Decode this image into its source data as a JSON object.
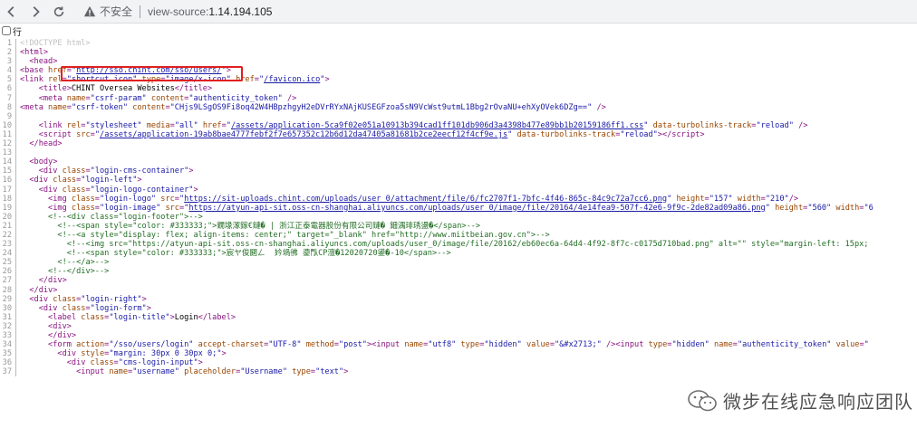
{
  "browser": {
    "secure_label": "不安全",
    "url_scheme": "view-source:",
    "url_host": "1.14.194.105"
  },
  "wrap_label": "行",
  "source_lines": [
    {
      "n": "1",
      "html": "<span class='dt'>&lt;!DOCTYPE html&gt;</span>"
    },
    {
      "n": "2",
      "html": "<span class='t'>&lt;html&gt;</span>"
    },
    {
      "n": "3",
      "html": "  <span class='t'>&lt;head&gt;</span>"
    },
    {
      "n": "4",
      "html": "<span class='t'>&lt;base </span><span class='a'>href</span><span class='t'>=</span><span class='v'>\"<span class='lnk'>http://sso.chint.com/sso/users/</span>\"</span><span class='t'>&gt;</span>"
    },
    {
      "n": "5",
      "html": "<span class='t'>&lt;link </span><span class='a'>rel</span><span class='t'>=</span><span class='v'>\"shortcut icon\"</span> <span class='a'>type</span><span class='t'>=</span><span class='v'>\"image/x-icon\"</span> <span class='a'>href</span><span class='t'>=</span><span class='v'>\"<span class='lnk'>/favicon.ico</span>\"</span><span class='t'>&gt;</span>"
    },
    {
      "n": "6",
      "html": "    <span class='t'>&lt;title&gt;</span>CHINT Oversea Websites<span class='t'>&lt;/title&gt;</span>"
    },
    {
      "n": "7",
      "html": "    <span class='t'>&lt;meta </span><span class='a'>name</span><span class='t'>=</span><span class='v'>\"csrf-param\"</span> <span class='a'>content</span><span class='t'>=</span><span class='v'>\"authenticity_token\"</span> <span class='t'>/&gt;</span>"
    },
    {
      "n": "8",
      "html": "<span class='t'>&lt;meta </span><span class='a'>name</span><span class='t'>=</span><span class='v'>\"csrf-token\"</span> <span class='a'>content</span><span class='t'>=</span><span class='v'>\"CHjs9LSgOS9Fi8oq42W4HBpzhgyH2eDVrRYxNAjKUSEGFzoa5sN9VcWst9utmL1Bbg2rOvaNU+ehXyOVek6DZg==\"</span> <span class='t'>/&gt;</span>"
    },
    {
      "n": "9",
      "html": ""
    },
    {
      "n": "10",
      "html": "    <span class='t'>&lt;link </span><span class='a'>rel</span><span class='t'>=</span><span class='v'>\"stylesheet\"</span> <span class='a'>media</span><span class='t'>=</span><span class='v'>\"all\"</span> <span class='a'>href</span><span class='t'>=</span><span class='v'>\"<span class='lnk'>/assets/application-5ca9f02e051a10913b394cad1ff101db906d3a4398b477e89bb1b20159186ff1.css</span>\"</span> <span class='a'>data-turbolinks-track</span><span class='t'>=</span><span class='v'>\"reload\"</span> <span class='t'>/&gt;</span>"
    },
    {
      "n": "11",
      "html": "    <span class='t'>&lt;script </span><span class='a'>src</span><span class='t'>=</span><span class='v'>\"<span class='lnk'>/assets/application-19ab8bae4777febf2f7e657352c12b6d12da47405a81681b2ce2eecf12f4cf9e.js</span>\"</span> <span class='a'>data-turbolinks-track</span><span class='t'>=</span><span class='v'>\"reload\"</span><span class='t'>&gt;&lt;/script&gt;</span>"
    },
    {
      "n": "12",
      "html": "  <span class='t'>&lt;/head&gt;</span>"
    },
    {
      "n": "13",
      "html": ""
    },
    {
      "n": "14",
      "html": "  <span class='t'>&lt;body&gt;</span>"
    },
    {
      "n": "15",
      "html": "    <span class='t'>&lt;div </span><span class='a'>class</span><span class='t'>=</span><span class='v'>\"login-cms-container\"</span><span class='t'>&gt;</span>"
    },
    {
      "n": "16",
      "html": "  <span class='t'>&lt;div </span><span class='a'>class</span><span class='t'>=</span><span class='v'>\"login-left\"</span><span class='t'>&gt;</span>"
    },
    {
      "n": "17",
      "html": "    <span class='t'>&lt;div </span><span class='a'>class</span><span class='t'>=</span><span class='v'>\"login-logo-container\"</span><span class='t'>&gt;</span>"
    },
    {
      "n": "18",
      "html": "      <span class='t'>&lt;img </span><span class='a'>class</span><span class='t'>=</span><span class='v'>\"login-logo\"</span> <span class='a'>src</span><span class='t'>=</span><span class='v'>\"<span class='lnk'>https://sit-uploads.chint.com/uploads/user_0/attachment/file/6/fc2707f1-7bfc-4f46-865c-84c9c72a7cc6.png</span>\"</span> <span class='a'>height</span><span class='t'>=</span><span class='v'>\"157\"</span> <span class='a'>width</span><span class='t'>=</span><span class='v'>\"210\"</span><span class='t'>/&gt;</span>"
    },
    {
      "n": "19",
      "html": "      <span class='t'>&lt;img </span><span class='a'>class</span><span class='t'>=</span><span class='v'>\"login-image\"</span> <span class='a'>src</span><span class='t'>=</span><span class='v'>\"<span class='lnk'>https://atyun-api-sit.oss-cn-shanghai.aliyuncs.com/uploads/user_0/image/file/20164/4e14fea9-507f-42e6-9f9c-2de82ad09a86.png</span>\"</span> <span class='a'>height</span><span class='t'>=</span><span class='v'>\"560\"</span> <span class='a'>width</span><span class='t'>=</span><span class='v'>\"6</span>"
    },
    {
      "n": "20",
      "html": "      <span class='c'>&lt;!--&lt;div class=\"login-footer\"&gt;--&gt;</span>"
    },
    {
      "n": "21",
      "html": "        <span class='c'>&lt;!--&lt;span style=\"color: #333333;\"&gt;鐗堟潈鎵€鏈� | 浙江正泰電器股份有限公司鏈� 鈿湡琲琇盪�&lt;/span&gt;--&gt;</span>"
    },
    {
      "n": "22",
      "html": "        <span class='c'>&lt;!--&lt;a style=\"display: flex; align-items: center;\" target=\"_blank\" href=\"http://www.miitbeian.gov.cn\"&gt;--&gt;</span>"
    },
    {
      "n": "23",
      "html": "          <span class='c'>&lt;!--&lt;img src=\"https://atyun-api-sit.oss-cn-shanghai.aliyuncs.com/uploads/user_0/image/file/20162/eb60ec6a-64d4-4f92-8f7c-c0175d710bad.png\" alt=\"\" style=\"margin-left: 15px;</span>"
    },
    {
      "n": "24",
      "html": "          <span class='c'>&lt;!--&lt;span style=\"color: #333333;\"&gt;宸ヤ俊閮ㄥ  妗堝彿 鍌閄CP澶�12020720鍙�-10&lt;/span&gt;--&gt;</span>"
    },
    {
      "n": "25",
      "html": "        <span class='c'>&lt;!--&lt;/a&gt;--&gt;</span>"
    },
    {
      "n": "26",
      "html": "      <span class='c'>&lt;!--&lt;/div&gt;--&gt;</span>"
    },
    {
      "n": "27",
      "html": "    <span class='t'>&lt;/div&gt;</span>"
    },
    {
      "n": "28",
      "html": "  <span class='t'>&lt;/div&gt;</span>"
    },
    {
      "n": "29",
      "html": "  <span class='t'>&lt;div </span><span class='a'>class</span><span class='t'>=</span><span class='v'>\"login-right\"</span><span class='t'>&gt;</span>"
    },
    {
      "n": "30",
      "html": "    <span class='t'>&lt;div </span><span class='a'>class</span><span class='t'>=</span><span class='v'>\"login-form\"</span><span class='t'>&gt;</span>"
    },
    {
      "n": "31",
      "html": "      <span class='t'>&lt;label </span><span class='a'>class</span><span class='t'>=</span><span class='v'>\"login-title\"</span><span class='t'>&gt;</span>Login<span class='t'>&lt;/label&gt;</span>"
    },
    {
      "n": "32",
      "html": "      <span class='t'>&lt;div&gt;</span>"
    },
    {
      "n": "33",
      "html": "      <span class='t'>&lt;/div&gt;</span>"
    },
    {
      "n": "34",
      "html": "      <span class='t'>&lt;form </span><span class='a'>action</span><span class='t'>=</span><span class='v'>\"/sso/users/login\"</span> <span class='a'>accept-charset</span><span class='t'>=</span><span class='v'>\"UTF-8\"</span> <span class='a'>method</span><span class='t'>=</span><span class='v'>\"post\"</span><span class='t'>&gt;&lt;input </span><span class='a'>name</span><span class='t'>=</span><span class='v'>\"utf8\"</span> <span class='a'>type</span><span class='t'>=</span><span class='v'>\"hidden\"</span> <span class='a'>value</span><span class='t'>=</span><span class='v'>\"&amp;#x2713;\"</span> <span class='t'>/&gt;&lt;input </span><span class='a'>type</span><span class='t'>=</span><span class='v'>\"hidden\"</span> <span class='a'>name</span><span class='t'>=</span><span class='v'>\"authenticity_token\"</span> <span class='a'>value</span><span class='t'>=</span><span class='v'>\"</span>"
    },
    {
      "n": "35",
      "html": "        <span class='t'>&lt;div </span><span class='a'>style</span><span class='t'>=</span><span class='v'>\"margin: 30px 0 30px 0;\"</span><span class='t'>&gt;</span>"
    },
    {
      "n": "36",
      "html": "          <span class='t'>&lt;div </span><span class='a'>class</span><span class='t'>=</span><span class='v'>\"cms-login-input\"</span><span class='t'>&gt;</span>"
    },
    {
      "n": "37",
      "html": "            <span class='t'>&lt;input </span><span class='a'>name</span><span class='t'>=</span><span class='v'>\"username\"</span> <span class='a'>placeholder</span><span class='t'>=</span><span class='v'>\"Username\"</span> <span class='a'>type</span><span class='t'>=</span><span class='v'>\"text\"</span><span class='t'>&gt;</span>"
    }
  ],
  "watermark": {
    "text": "微步在线应急响应团队"
  },
  "colors": {
    "highlight": "#e02020",
    "tag": "#881280",
    "attr": "#994500",
    "value": "#1a1aa6",
    "comment": "#236e25"
  }
}
